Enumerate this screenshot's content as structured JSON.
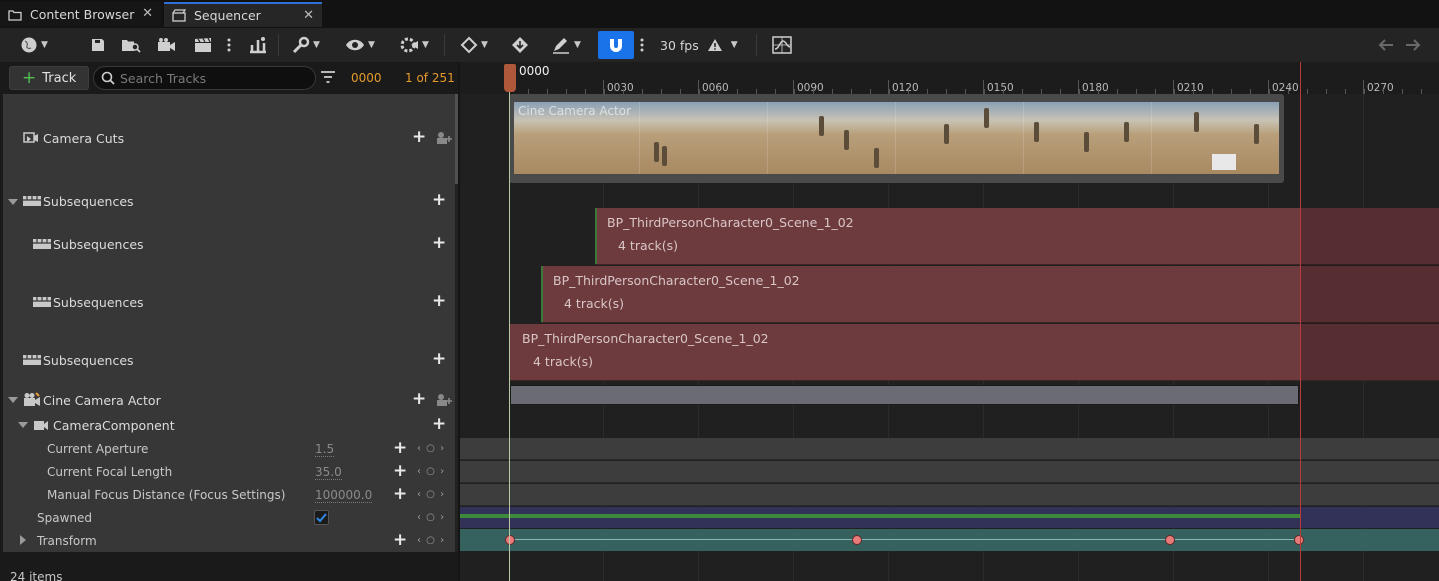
{
  "tabs": [
    {
      "label": "Content Browser",
      "close": "✕"
    },
    {
      "label": "Sequencer",
      "close": "✕"
    }
  ],
  "toolbar": {
    "fps_label": "30 fps",
    "snap_color": "#1a73e8"
  },
  "left": {
    "add_track_label": "Track",
    "add_track_plus": "+",
    "search_placeholder": "Search Tracks",
    "current_frame": "0000",
    "frame_count": "1 of 251",
    "items_count": "24 items",
    "tree": {
      "camera_cuts": "Camera Cuts",
      "subsequences_root": "Subsequences",
      "subsequences_1": "Subsequences",
      "subsequences_2": "Subsequences",
      "subsequences_3": "Subsequences",
      "cine_camera_actor": "Cine Camera Actor",
      "camera_component": "CameraComponent",
      "current_aperture": "Current Aperture",
      "current_aperture_value": "1.5",
      "current_focal_length": "Current Focal Length",
      "current_focal_length_value": "35.0",
      "manual_focus_distance": "Manual Focus Distance (Focus Settings)",
      "manual_focus_distance_value": "100000.0",
      "spawned": "Spawned",
      "spawned_checked": true,
      "transform": "Transform",
      "plus": "+",
      "keynav": "‹ ○ ›"
    }
  },
  "timeline": {
    "scrub_frame": "0000",
    "ticks": [
      "0030",
      "0060",
      "0090",
      "0120",
      "0150",
      "0180",
      "0210",
      "0240",
      "0270"
    ],
    "cine_label": "Cine Camera Actor",
    "subsequences": [
      {
        "name": "BP_ThirdPersonCharacter0_Scene_1_02",
        "tracks": "4 track(s)"
      },
      {
        "name": "BP_ThirdPersonCharacter0_Scene_1_02",
        "tracks": "4 track(s)"
      },
      {
        "name": "BP_ThirdPersonCharacter0_Scene_1_02",
        "tracks": "4 track(s)"
      }
    ],
    "colors": {
      "subsequence": "#6d3a3e",
      "playhead": "#b7c9a2",
      "end_marker": "#b83a3a",
      "key": "#e87a7a"
    }
  }
}
